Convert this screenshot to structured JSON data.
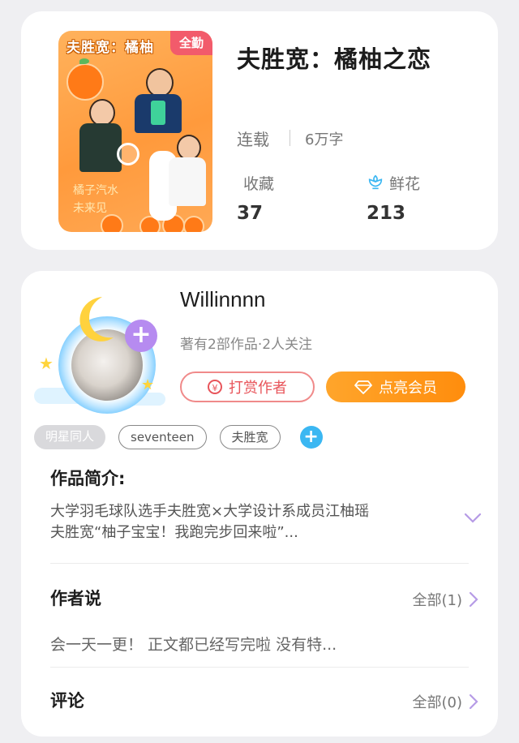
{
  "book": {
    "cover_title": "夫胜宽：橘柚",
    "cover_badge": "全勤",
    "cover_handwriting": [
      "橘子汽水",
      "未来见"
    ],
    "title": "夫胜宽：橘柚之恋",
    "status": "连载",
    "word_count": "6万字",
    "favorites_label": "收藏",
    "favorites_count": "37",
    "flowers_label": "鲜花",
    "flowers_count": "213"
  },
  "author": {
    "name": "Willinnnn",
    "meta": "著有2部作品·2人关注",
    "tip_button": "打赏作者",
    "vip_button": "点亮会员",
    "tags": [
      "明星同人",
      "seventeen",
      "夫胜宽"
    ]
  },
  "intro": {
    "heading": "作品简介:",
    "line1": "大学羽毛球队选手夫胜宽×大学设计系成员江柚瑶",
    "line2": "夫胜宽“柚子宝宝！我跑完步回来啦”..."
  },
  "author_note": {
    "heading": "作者说",
    "all_link": "全部(1)",
    "text": "会一天一更！ 正文都已经写完啦 没有特..."
  },
  "comments": {
    "heading": "评论",
    "all_link": "全部(0)"
  },
  "colors": {
    "accent_orange": "#ff9a1f",
    "tip_red": "#e8545a",
    "tag_blue": "#3bb7f2",
    "plus_purple": "#b68bf0"
  }
}
